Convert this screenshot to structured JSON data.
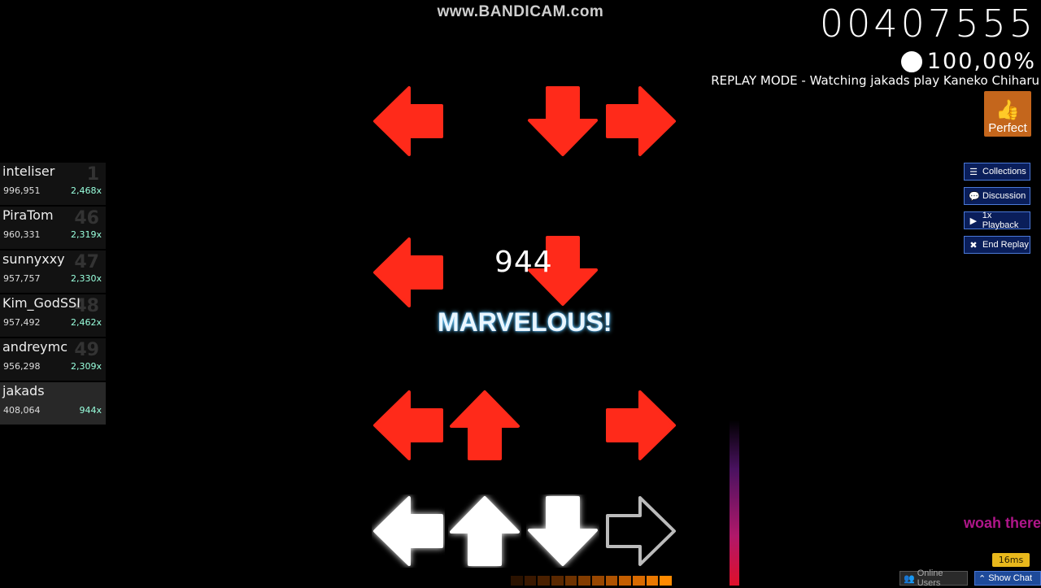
{
  "watermark": "www.BANDICAM.com",
  "hud": {
    "score": "00407555",
    "accuracy": "100,00%",
    "replay_text": "REPLAY MODE - Watching jakads play Kaneko Chiharu",
    "rank_label": "Perfect",
    "combo": "944",
    "judgement": "MARVELOUS!",
    "health": 0.85
  },
  "side_buttons": [
    {
      "label": "Collections",
      "icon": "list-icon"
    },
    {
      "label": "Discussion",
      "icon": "chat-bubble-icon"
    },
    {
      "label": "1x Playback",
      "icon": "play-icon"
    },
    {
      "label": "End Replay",
      "icon": "close-icon"
    }
  ],
  "leaderboard": [
    {
      "name": "inteliser",
      "score": "996,951",
      "combo": "2,468x",
      "rank": "1"
    },
    {
      "name": "PiraTom",
      "score": "960,331",
      "combo": "2,319x",
      "rank": "46"
    },
    {
      "name": "sunnyxxy",
      "score": "957,757",
      "combo": "2,330x",
      "rank": "47"
    },
    {
      "name": "Kim_GodSSI",
      "score": "957,492",
      "combo": "2,462x",
      "rank": "48"
    },
    {
      "name": "andreymc",
      "score": "956,298",
      "combo": "2,309x",
      "rank": "49"
    },
    {
      "name": "jakads",
      "score": "408,064",
      "combo": "944x",
      "rank": ""
    }
  ],
  "chat": {
    "message": "woah there"
  },
  "latency": "16ms",
  "bottom_bar": {
    "online_users": "Online Users",
    "show_chat": "Show Chat"
  },
  "colors": {
    "note": "#ff2a1a",
    "receptor": "#ffffff",
    "rank_badge": "#c4661c",
    "button_bg": "#0a1e5a",
    "button_border": "#4a78d8",
    "chat": "#b0168a"
  }
}
